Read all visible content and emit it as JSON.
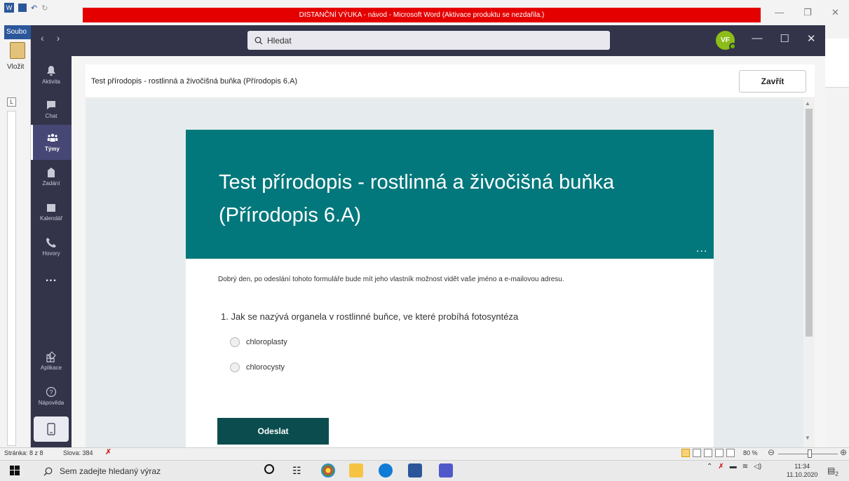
{
  "word": {
    "title": "DISTANČNÍ VÝUKA - návod - Microsoft Word (Aktivace produktu se nezdařila.)",
    "file_tab": "Soubo",
    "paste_label": "Vložit",
    "ruler_tab": "L",
    "status": {
      "page": "Stránka: 8 z 8",
      "words": "Slova: 384",
      "zoom": "80 %"
    }
  },
  "teams": {
    "search_placeholder": "Hledat",
    "avatar_initials": "VF",
    "rail": [
      {
        "label": "Aktivita",
        "icon": "bell-icon"
      },
      {
        "label": "Chat",
        "icon": "chat-icon"
      },
      {
        "label": "Týmy",
        "icon": "teams-icon"
      },
      {
        "label": "Zadání",
        "icon": "assignments-icon"
      },
      {
        "label": "Kalendář",
        "icon": "calendar-icon"
      },
      {
        "label": "Hovory",
        "icon": "phone-icon"
      },
      {
        "label": "Aplikace",
        "icon": "apps-icon"
      },
      {
        "label": "Nápověda",
        "icon": "help-icon"
      }
    ],
    "more_label": "...",
    "header_title": "Test přírodopis - rostlinná a živočišná buňka (Přírodopis 6.A)",
    "close_label": "Zavřít"
  },
  "form": {
    "title": "Test přírodopis - rostlinná a živočišná buňka (Přírodopis 6.A)",
    "more": "...",
    "privacy_note": "Dobrý den, po odeslání tohoto formuláře bude mít jeho vlastník možnost vidět vaše jméno a e-mailovou adresu.",
    "question": "1. Jak se nazývá organela v rostlinné buňce, ve které probíhá fotosyntéza",
    "options": [
      "chloroplasty",
      "chlorocysty"
    ],
    "submit_label": "Odeslat"
  },
  "taskbar": {
    "search_placeholder": "Sem zadejte hledaný výraz",
    "clock_time": "11:34",
    "clock_date": "11.10.2020",
    "notification_count": "2"
  },
  "colors": {
    "teams_dark": "#33344a",
    "form_banner": "#03787c",
    "submit_button": "#0b4d4f",
    "title_bar_red": "#e50000"
  }
}
